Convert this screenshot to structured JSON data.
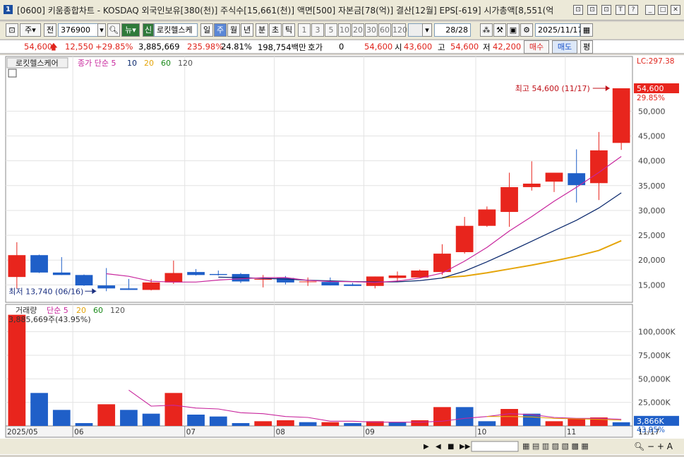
{
  "window": {
    "icon_label": "1",
    "title": "[0600] 키움종합차트 - KOSDAQ 외국인보유[380(천)] 주식수[15,661(천)] 액면[500] 자본금[78(억)] 결산[12월] EPS[-619] 시가총액[8,551(억",
    "buttons": [
      "⊡",
      "⊡",
      "⊡",
      "T",
      "?",
      "_",
      "□",
      "✕"
    ]
  },
  "toolbar": {
    "period_select": "주",
    "prev_label": "전",
    "stock_code": "376900",
    "news_label": "뉴",
    "credit_badge": "신",
    "stock_name": "로킷헬스케",
    "period_tabs": [
      "일",
      "주",
      "월",
      "년",
      "분",
      "초",
      "틱"
    ],
    "active_period": "주",
    "interval_buttons": [
      "1",
      "3",
      "5",
      "10",
      "20",
      "30",
      "60",
      "120"
    ],
    "page_counter": "28/28",
    "date_value": "2025/11/17"
  },
  "quote": {
    "price": "54,600",
    "change": "12,550",
    "change_pct": "+29.85%",
    "volume": "3,885,669",
    "volume_ratio": "235.98%",
    "turnover": "24.81%",
    "amount": "198,754백만",
    "bid_label": "호가",
    "bid_value": "0",
    "price2": "54,600",
    "open_label": "시",
    "open_value": "43,600",
    "high_label": "고",
    "high_value": "54,600",
    "low_label": "저",
    "low_value": "42,200",
    "buy_button": "매수",
    "sell_button": "매도",
    "eval_button": "평"
  },
  "colors": {
    "up": "#e8251d",
    "down": "#1f5fc8",
    "ma5": "#c8269d",
    "ma10": "#0c2a6e",
    "ma20": "#e5a50a",
    "ma60": "#1a8a1a",
    "ma120": "#555555"
  },
  "chart_data": [
    {
      "type": "candlestick",
      "legend": {
        "name": "로킷헬스케어",
        "ma_label": "종가 단순",
        "periods": [
          "5",
          "10",
          "20",
          "60",
          "120"
        ]
      },
      "y_ticks": [
        15000,
        20000,
        25000,
        30000,
        35000,
        40000,
        45000,
        50000
      ],
      "y_tick_labels": [
        "15,000",
        "20,000",
        "25,000",
        "30,000",
        "35,000",
        "40,000",
        "45,000",
        "50,000"
      ],
      "ylim": [
        11500,
        61000
      ],
      "x_labels": [
        "2025/05",
        "06",
        "07",
        "08",
        "09",
        "10",
        "11",
        "11/17"
      ],
      "x_label_bar_index": [
        0,
        3,
        8,
        12,
        16,
        21,
        25
      ],
      "max_annotation": "최고 54,600 (11/17)",
      "min_annotation": "최저 13,740 (06/16)",
      "price_tag": "54,600",
      "lc_label": "LC:297.38",
      "pct_label": "29.85%",
      "candles": [
        {
          "o": 16600,
          "h": 23600,
          "l": 14300,
          "c": 21000
        },
        {
          "o": 21000,
          "h": 21100,
          "l": 17400,
          "c": 17500
        },
        {
          "o": 17500,
          "h": 20600,
          "l": 17000,
          "c": 17000
        },
        {
          "o": 17000,
          "h": 17100,
          "l": 14800,
          "c": 14900
        },
        {
          "o": 14900,
          "h": 18400,
          "l": 13740,
          "c": 14300
        },
        {
          "o": 14300,
          "h": 16200,
          "l": 14000,
          "c": 14000
        },
        {
          "o": 14000,
          "h": 16200,
          "l": 13900,
          "c": 15500
        },
        {
          "o": 15500,
          "h": 19900,
          "l": 15200,
          "c": 17400
        },
        {
          "o": 17600,
          "h": 18200,
          "l": 16900,
          "c": 17000
        },
        {
          "o": 17200,
          "h": 17900,
          "l": 16900,
          "c": 17000
        },
        {
          "o": 17200,
          "h": 17400,
          "l": 15400,
          "c": 15700
        },
        {
          "o": 16200,
          "h": 17000,
          "l": 14500,
          "c": 16200
        },
        {
          "o": 16400,
          "h": 16800,
          "l": 15100,
          "c": 15500
        },
        {
          "o": 15700,
          "h": 16500,
          "l": 14800,
          "c": 15700
        },
        {
          "o": 15600,
          "h": 16500,
          "l": 14900,
          "c": 14900
        },
        {
          "o": 15100,
          "h": 15400,
          "l": 14800,
          "c": 14800
        },
        {
          "o": 14800,
          "h": 16700,
          "l": 14300,
          "c": 16700
        },
        {
          "o": 16400,
          "h": 17700,
          "l": 15700,
          "c": 16900
        },
        {
          "o": 16500,
          "h": 18100,
          "l": 16500,
          "c": 17900
        },
        {
          "o": 17600,
          "h": 23200,
          "l": 17000,
          "c": 21300
        },
        {
          "o": 21600,
          "h": 28700,
          "l": 21300,
          "c": 26900
        },
        {
          "o": 26900,
          "h": 30800,
          "l": 26700,
          "c": 30200
        },
        {
          "o": 29700,
          "h": 37600,
          "l": 26700,
          "c": 34700
        },
        {
          "o": 34700,
          "h": 39900,
          "l": 34000,
          "c": 35400
        },
        {
          "o": 35800,
          "h": 37600,
          "l": 33700,
          "c": 37600
        },
        {
          "o": 37500,
          "h": 42300,
          "l": 31600,
          "c": 35100
        },
        {
          "o": 35500,
          "h": 45800,
          "l": 32100,
          "c": 42100
        },
        {
          "o": 43600,
          "h": 54600,
          "l": 42200,
          "c": 54600
        }
      ],
      "ma5": [
        null,
        null,
        null,
        null,
        17260,
        16740,
        15740,
        15580,
        15580,
        15980,
        16240,
        16460,
        16480,
        15920,
        15700,
        15660,
        15500,
        15780,
        16380,
        17390,
        19780,
        22560,
        25870,
        28770,
        31860,
        34660,
        37660,
        40870
      ],
      "ma10": [
        null,
        null,
        null,
        null,
        null,
        null,
        null,
        null,
        null,
        16570,
        16480,
        16320,
        16180,
        15950,
        15810,
        15680,
        15600,
        15630,
        15870,
        16390,
        17780,
        19650,
        21690,
        23800,
        25930,
        28030,
        30490,
        33550
      ],
      "ma20": [
        null,
        null,
        null,
        null,
        null,
        null,
        null,
        null,
        null,
        null,
        null,
        null,
        null,
        null,
        null,
        null,
        null,
        null,
        null,
        16470,
        16780,
        17440,
        18210,
        18990,
        19850,
        20790,
        21950,
        23900
      ]
    },
    {
      "type": "bar",
      "legend": {
        "name": "거래량",
        "ma_label": "단순",
        "periods": [
          "5",
          "20",
          "60",
          "120"
        ]
      },
      "y_ticks": [
        25000,
        50000,
        75000,
        100000
      ],
      "y_tick_labels": [
        "25,000K",
        "50,000K",
        "75,000K",
        "100,000K"
      ],
      "ylim": [
        0,
        120000
      ],
      "volume_label": "3,885,669주(43.95%)",
      "volume_tag": "3,866K",
      "pct_label": "43.95%",
      "bars": [
        {
          "v": 118000,
          "dir": "up"
        },
        {
          "v": 35000,
          "dir": "down"
        },
        {
          "v": 17000,
          "dir": "down"
        },
        {
          "v": 3000,
          "dir": "down"
        },
        {
          "v": 23000,
          "dir": "up"
        },
        {
          "v": 17000,
          "dir": "down"
        },
        {
          "v": 13000,
          "dir": "down"
        },
        {
          "v": 35000,
          "dir": "up"
        },
        {
          "v": 12000,
          "dir": "down"
        },
        {
          "v": 10000,
          "dir": "down"
        },
        {
          "v": 3000,
          "dir": "down"
        },
        {
          "v": 5000,
          "dir": "up"
        },
        {
          "v": 6000,
          "dir": "up"
        },
        {
          "v": 4000,
          "dir": "down"
        },
        {
          "v": 4000,
          "dir": "up"
        },
        {
          "v": 3000,
          "dir": "down"
        },
        {
          "v": 5000,
          "dir": "up"
        },
        {
          "v": 4000,
          "dir": "down"
        },
        {
          "v": 6000,
          "dir": "up"
        },
        {
          "v": 20000,
          "dir": "up"
        },
        {
          "v": 20000,
          "dir": "down"
        },
        {
          "v": 5000,
          "dir": "down"
        },
        {
          "v": 18000,
          "dir": "up"
        },
        {
          "v": 13000,
          "dir": "down"
        },
        {
          "v": 5000,
          "dir": "up"
        },
        {
          "v": 8000,
          "dir": "up"
        },
        {
          "v": 9000,
          "dir": "up"
        },
        {
          "v": 3886,
          "dir": "down"
        }
      ],
      "ma5": [
        null,
        null,
        null,
        null,
        null,
        38000,
        21000,
        22000,
        19000,
        18000,
        14000,
        13000,
        10000,
        9000,
        5000,
        5000,
        4000,
        4000,
        4000,
        5000,
        8000,
        10000,
        13000,
        12000,
        9000,
        8000,
        8000,
        7000
      ],
      "ma20": [
        null,
        null,
        null,
        null,
        null,
        null,
        null,
        null,
        null,
        null,
        null,
        null,
        null,
        null,
        null,
        null,
        null,
        null,
        null,
        null,
        null,
        10000,
        10000,
        9500,
        8000,
        7500,
        7000,
        6000
      ]
    }
  ]
}
